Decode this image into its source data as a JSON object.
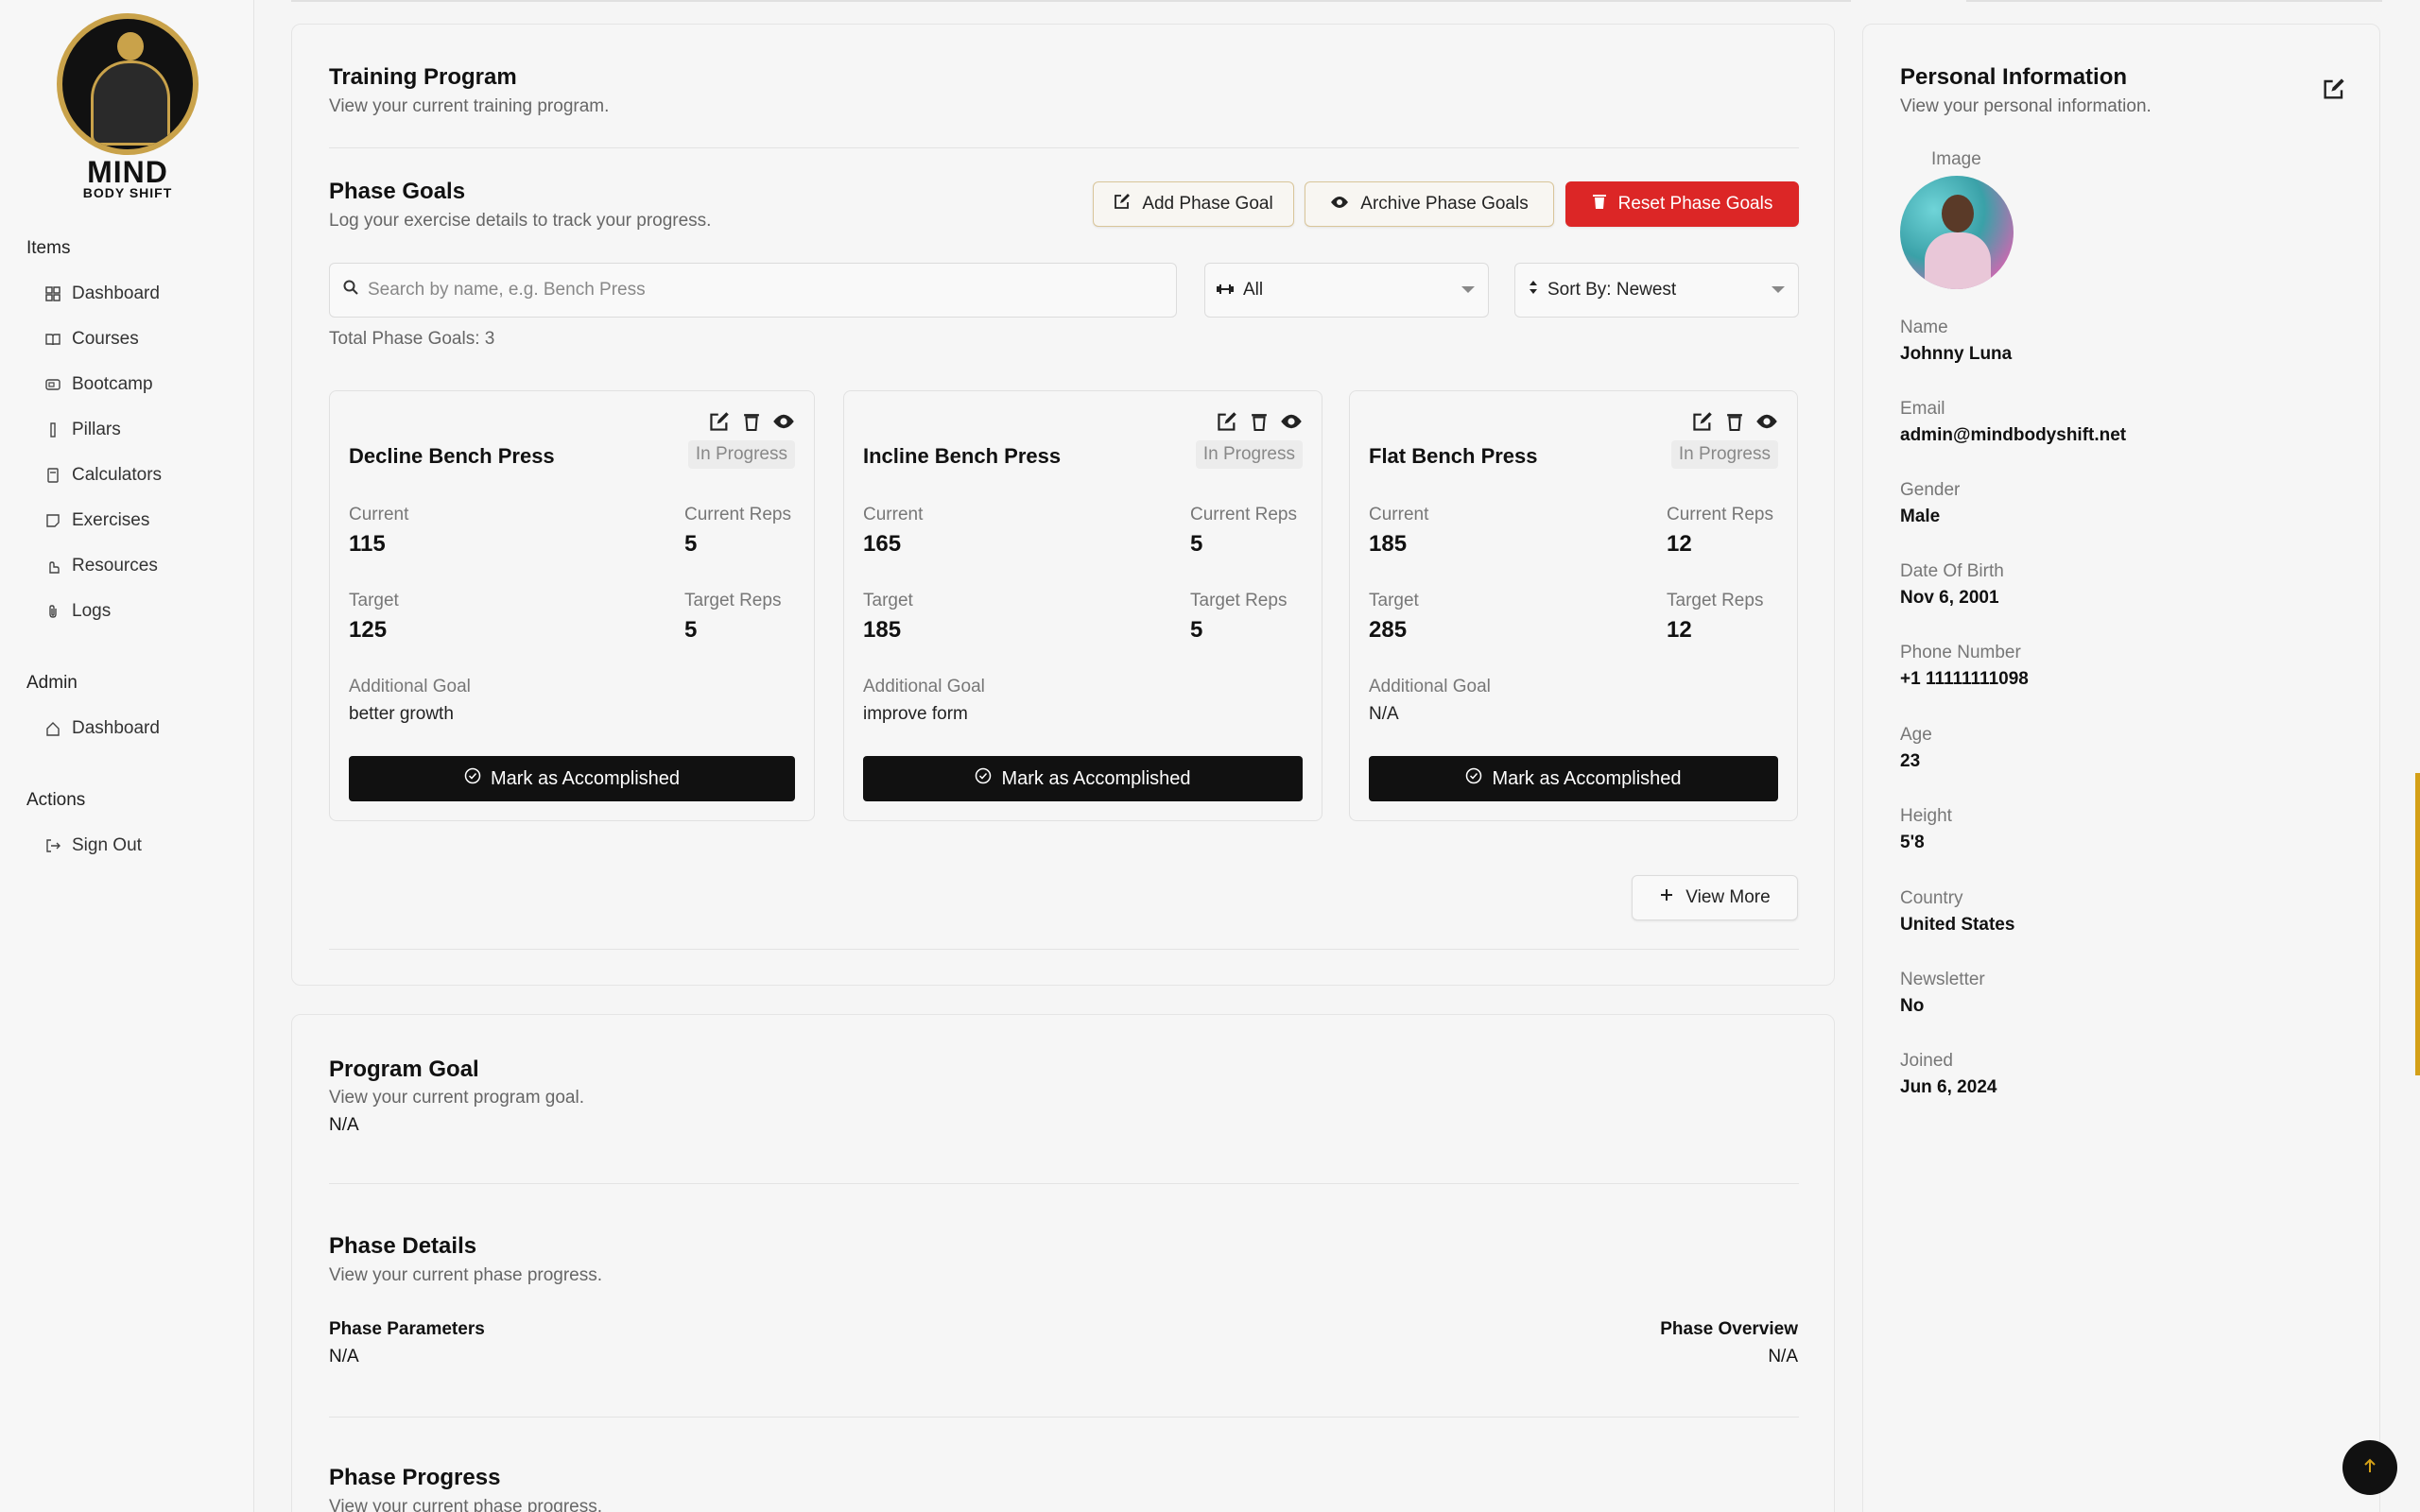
{
  "brand": {
    "word_main": "MIND",
    "word_sub": "BODY SHIFT"
  },
  "sidebar": {
    "sections": [
      {
        "title": "Items",
        "items": [
          {
            "label": "Dashboard",
            "icon": "grid-icon"
          },
          {
            "label": "Courses",
            "icon": "book-icon"
          },
          {
            "label": "Bootcamp",
            "icon": "tent-icon"
          },
          {
            "label": "Pillars",
            "icon": "pillar-icon"
          },
          {
            "label": "Calculators",
            "icon": "calculator-icon"
          },
          {
            "label": "Exercises",
            "icon": "note-icon"
          },
          {
            "label": "Resources",
            "icon": "hand-icon"
          },
          {
            "label": "Logs",
            "icon": "paperclip-icon"
          }
        ]
      },
      {
        "title": "Admin",
        "items": [
          {
            "label": "Dashboard",
            "icon": "home-icon"
          }
        ]
      },
      {
        "title": "Actions",
        "items": [
          {
            "label": "Sign Out",
            "icon": "sign-out-icon"
          }
        ]
      }
    ]
  },
  "training": {
    "title": "Training Program",
    "subtitle": "View your current training program.",
    "phase_goals": {
      "title": "Phase Goals",
      "subtitle": "Log your exercise details to track your progress.",
      "add_label": "Add Phase Goal",
      "archive_label": "Archive Phase Goals",
      "reset_label": "Reset Phase Goals",
      "search_placeholder": "Search by name, e.g. Bench Press",
      "filter_value": "All",
      "sort_value": "Sort By: Newest",
      "total": "Total Phase Goals: 3",
      "labels": {
        "current": "Current",
        "current_reps": "Current Reps",
        "target": "Target",
        "target_reps": "Target Reps",
        "additional": "Additional Goal",
        "mark": "Mark as Accomplished"
      },
      "goals": [
        {
          "name": "Decline Bench Press",
          "status": "In Progress",
          "current": "115",
          "current_reps": "5",
          "target": "125",
          "target_reps": "5",
          "additional": "better growth"
        },
        {
          "name": "Incline Bench Press",
          "status": "In Progress",
          "current": "165",
          "current_reps": "5",
          "target": "185",
          "target_reps": "5",
          "additional": "improve form"
        },
        {
          "name": "Flat Bench Press",
          "status": "In Progress",
          "current": "185",
          "current_reps": "12",
          "target": "285",
          "target_reps": "12",
          "additional": "N/A"
        }
      ],
      "view_more": "View More"
    }
  },
  "program_goal": {
    "title": "Program Goal",
    "subtitle": "View your current program goal.",
    "value": "N/A"
  },
  "phase_details": {
    "title": "Phase Details",
    "subtitle": "View your current phase progress.",
    "params_label": "Phase Parameters",
    "params_value": "N/A",
    "overview_label": "Phase Overview",
    "overview_value": "N/A"
  },
  "phase_progress": {
    "title": "Phase Progress",
    "subtitle": "View your current phase progress."
  },
  "personal": {
    "title": "Personal Information",
    "subtitle": "View your personal information.",
    "image_label": "Image",
    "fields": [
      {
        "label": "Name",
        "value": "Johnny Luna"
      },
      {
        "label": "Email",
        "value": "admin@mindbodyshift.net"
      },
      {
        "label": "Gender",
        "value": "Male"
      },
      {
        "label": "Date Of Birth",
        "value": "Nov 6, 2001"
      },
      {
        "label": "Phone Number",
        "value": "+1 11111111098"
      },
      {
        "label": "Age",
        "value": "23"
      },
      {
        "label": "Height",
        "value": "5'8"
      },
      {
        "label": "Country",
        "value": "United States"
      },
      {
        "label": "Newsletter",
        "value": "No"
      },
      {
        "label": "Joined",
        "value": "Jun 6, 2024"
      }
    ]
  },
  "colors": {
    "accent_red": "#dc2626",
    "brand_gold": "#c9a24a",
    "dark": "#111111"
  }
}
